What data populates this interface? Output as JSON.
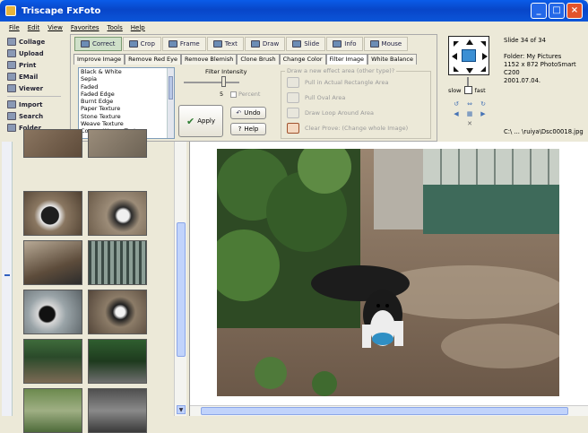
{
  "window": {
    "title": "Triscape FxFoto"
  },
  "menu": [
    "File",
    "Edit",
    "View",
    "Favorites",
    "Tools",
    "Help"
  ],
  "leftnav": {
    "items": [
      "Collage",
      "Upload",
      "Print",
      "EMail",
      "Viewer"
    ],
    "items2": [
      "Import",
      "Search",
      "Folder"
    ]
  },
  "tooltabs": [
    "Correct",
    "Crop",
    "Frame",
    "Text",
    "Draw",
    "Slide",
    "Info",
    "Mouse"
  ],
  "subtabs": [
    "Improve Image",
    "Remove Red Eye",
    "Remove Blemish",
    "Clone Brush",
    "Change Color",
    "Filter Image",
    "White Balance"
  ],
  "filters": [
    "Black & White",
    "Sepia",
    "Faded",
    "Faded Edge",
    "Burnt Edge",
    "Paper Texture",
    "Stone Texture",
    "Weave Texture",
    "Coarse Weave Texture"
  ],
  "intensity": {
    "label": "Filter Intensity",
    "value": "5",
    "percent_label": "Percent"
  },
  "buttons": {
    "apply": "Apply",
    "undo": "Undo",
    "help": "Help"
  },
  "area": {
    "legend": "Draw a new effect area (other type)?",
    "options": [
      "Pull in Actual Rectangle Area",
      "Pull Oval Area",
      "Draw Loop Around Area",
      "Clear Prove: (Change whole Image)"
    ]
  },
  "speed": {
    "slow": "slow",
    "fast": "fast"
  },
  "info": {
    "slide": "Slide 34 of 34",
    "folder": "Folder: My Pictures",
    "details": "1152 x 872  PhotoSmart C200",
    "date": "2001.07.04.",
    "path": "C:\\ ... \\ruiya\\Dsc00018.jpg"
  },
  "colors": {
    "titlebar": "#0A5CE8",
    "active_tab": "#CFE0C9"
  }
}
